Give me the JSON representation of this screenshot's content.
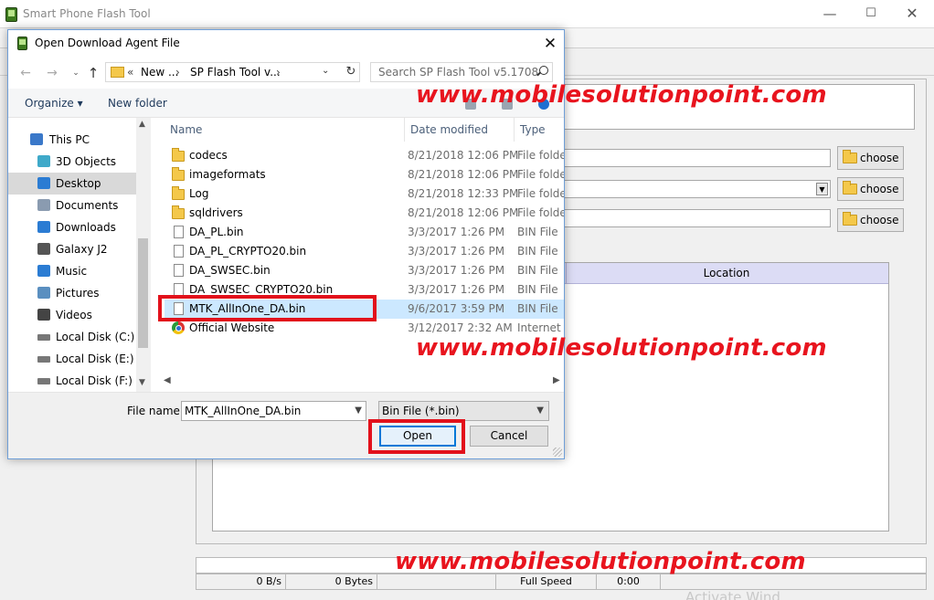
{
  "main_window": {
    "title": "Smart Phone Flash Tool",
    "minimize_glyph": "—",
    "maximize_glyph": "☐",
    "close_glyph": "✕",
    "choose_label": "choose",
    "table": {
      "location_header": "Location"
    },
    "status": {
      "speed": "0 B/s",
      "bytes": "0 Bytes",
      "usb_mode": "Full Speed",
      "time": "0:00"
    },
    "activate_hint": "Activate Wind"
  },
  "watermark": "www.mobilesolutionpoint.com",
  "dialog": {
    "title": "Open Download Agent File",
    "close_glyph": "✕",
    "nav": {
      "back_glyph": "←",
      "forward_glyph": "→",
      "recent_glyph": "⌄",
      "up_glyph": "↑",
      "refresh_glyph": "↻"
    },
    "address": {
      "chevron": "«",
      "seg1": "New ...",
      "seg2": "SP Flash Tool v...",
      "sep": "›",
      "dropdown_glyph": "⌄"
    },
    "search": {
      "placeholder": "Search SP Flash Tool v5.1708"
    },
    "commands": {
      "organize": "Organize ▾",
      "new_folder": "New folder"
    },
    "nav_pane": {
      "items": [
        {
          "label": "This PC",
          "icon": "monitor-icon"
        },
        {
          "label": "3D Objects",
          "icon": "cube-icon"
        },
        {
          "label": "Desktop",
          "icon": "desktop-icon",
          "selected": true
        },
        {
          "label": "Documents",
          "icon": "document-icon"
        },
        {
          "label": "Downloads",
          "icon": "download-icon"
        },
        {
          "label": "Galaxy J2",
          "icon": "phone-icon"
        },
        {
          "label": "Music",
          "icon": "music-icon"
        },
        {
          "label": "Pictures",
          "icon": "pictures-icon"
        },
        {
          "label": "Videos",
          "icon": "video-icon"
        },
        {
          "label": "Local Disk (C:)",
          "icon": "drive-icon"
        },
        {
          "label": "Local Disk (E:)",
          "icon": "drive-icon"
        },
        {
          "label": "Local Disk (F:)",
          "icon": "drive-icon"
        }
      ]
    },
    "columns": {
      "name": "Name",
      "date": "Date modified",
      "type": "Type"
    },
    "files": [
      {
        "name": "codecs",
        "date": "8/21/2018 12:06 PM",
        "type": "File folder",
        "icon": "folder"
      },
      {
        "name": "imageformats",
        "date": "8/21/2018 12:06 PM",
        "type": "File folder",
        "icon": "folder"
      },
      {
        "name": "Log",
        "date": "8/21/2018 12:33 PM",
        "type": "File folder",
        "icon": "folder"
      },
      {
        "name": "sqldrivers",
        "date": "8/21/2018 12:06 PM",
        "type": "File folder",
        "icon": "folder"
      },
      {
        "name": "DA_PL.bin",
        "date": "3/3/2017 1:26 PM",
        "type": "BIN File",
        "icon": "file"
      },
      {
        "name": "DA_PL_CRYPTO20.bin",
        "date": "3/3/2017 1:26 PM",
        "type": "BIN File",
        "icon": "file"
      },
      {
        "name": "DA_SWSEC.bin",
        "date": "3/3/2017 1:26 PM",
        "type": "BIN File",
        "icon": "file"
      },
      {
        "name": "DA_SWSEC_CRYPTO20.bin",
        "date": "3/3/2017 1:26 PM",
        "type": "BIN File",
        "icon": "file"
      },
      {
        "name": "MTK_AllInOne_DA.bin",
        "date": "9/6/2017 3:59 PM",
        "type": "BIN File",
        "icon": "file",
        "selected": true
      },
      {
        "name": "Official Website",
        "date": "3/12/2017 2:32 AM",
        "type": "Internet S",
        "icon": "web"
      }
    ],
    "filename_label": "File name:",
    "filename_value": "MTK_AllInOne_DA.bin",
    "filetype_value": "Bin File (*.bin)",
    "open_label": "Open",
    "cancel_label": "Cancel"
  }
}
